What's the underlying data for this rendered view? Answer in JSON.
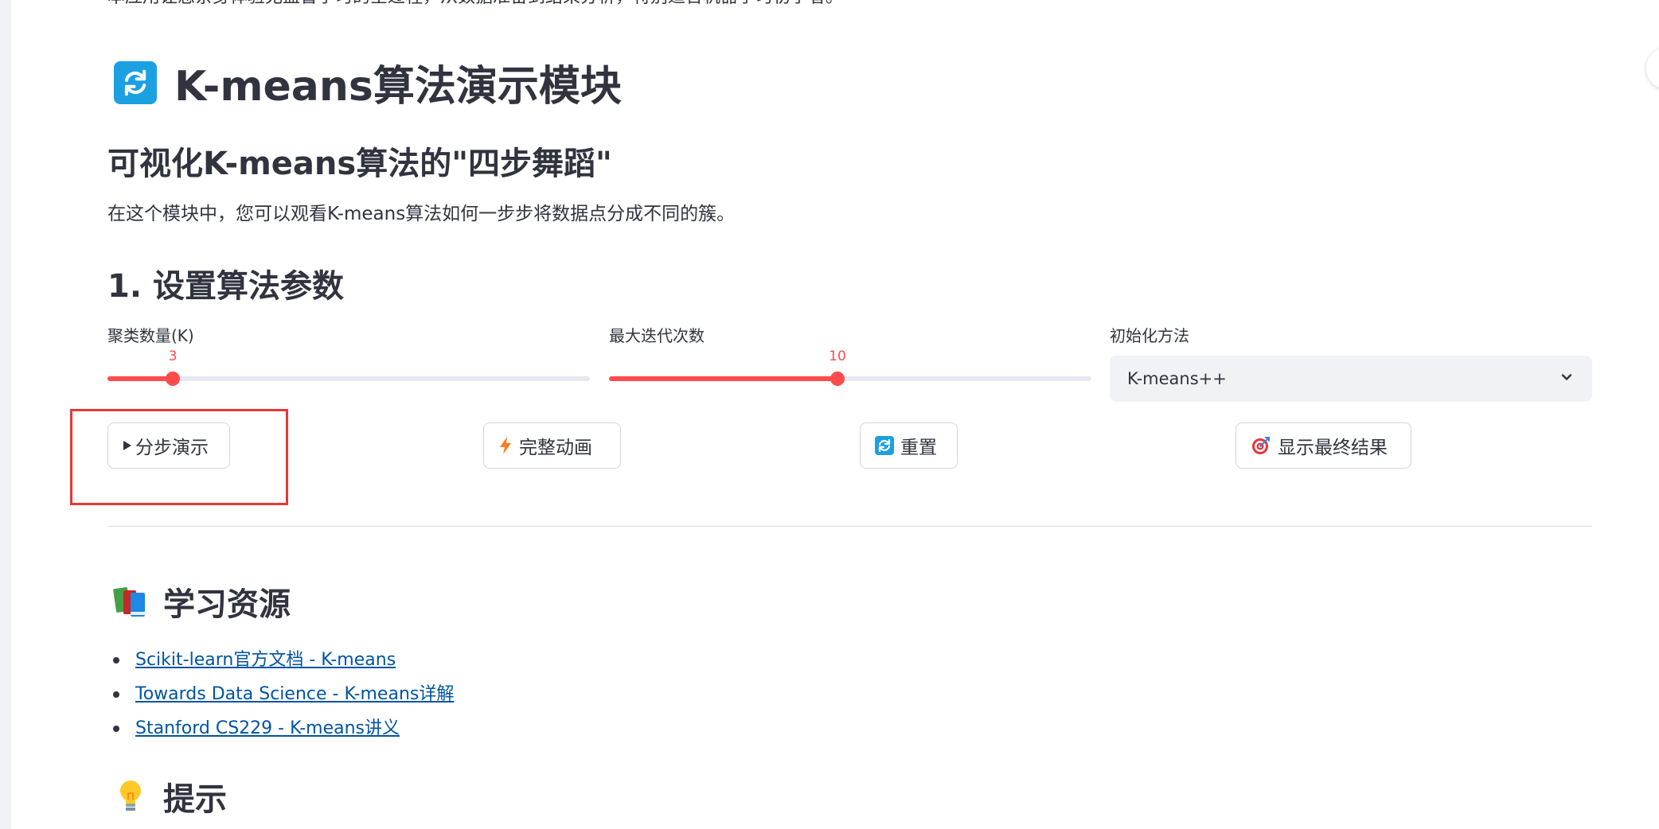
{
  "intro_text": "本应用让您亲身体验无监督学习的全过程，从数据准备到结果分析，特别适合机器学习初学者。",
  "module_title": "K-means算法演示模块",
  "module_icon": "refresh-icon",
  "subtitle": "可视化K-means算法的\"四步舞蹈\"",
  "description": "在这个模块中，您可以观看K-means算法如何一步步将数据点分成不同的簇。",
  "params_heading": "1. 设置算法参数",
  "controls": {
    "k_slider": {
      "label": "聚类数量(K)",
      "value": "3",
      "fraction": 0.136
    },
    "iter_slider": {
      "label": "最大迭代次数",
      "value": "10",
      "fraction": 0.474
    },
    "init_select": {
      "label": "初始化方法",
      "value": "K-means++"
    }
  },
  "buttons": {
    "step": {
      "label": "分步演示",
      "icon": "play-icon"
    },
    "animate": {
      "label": "完整动画",
      "icon": "lightning-icon"
    },
    "reset": {
      "label": "重置",
      "icon": "refresh-icon"
    },
    "result": {
      "label": "显示最终结果",
      "icon": "target-icon"
    }
  },
  "resources": {
    "heading": "学习资源",
    "icon": "books-icon",
    "links": [
      "Scikit-learn官方文档 - K-means",
      "Towards Data Science - K-means详解",
      "Stanford CS229 - K-means讲义"
    ]
  },
  "tips": {
    "heading": "提示",
    "icon": "lightbulb-icon"
  },
  "colors": {
    "accent": "#ff4b4b",
    "link": "#0054a3",
    "highlight_box": "#e53935",
    "icon_blue": "#1ba1e2"
  }
}
